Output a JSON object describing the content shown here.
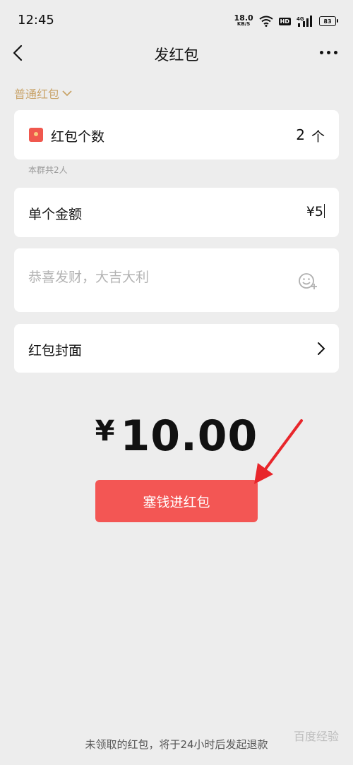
{
  "status_bar": {
    "time": "12:45",
    "net_speed": "18.0",
    "net_speed_unit": "KB/S",
    "hd_label": "HD",
    "signal_label": "4G",
    "battery": "83"
  },
  "nav": {
    "title": "发红包"
  },
  "packet_type": {
    "label": "普通红包"
  },
  "count_card": {
    "label": "红包个数",
    "value": "2",
    "unit": "个"
  },
  "group_hint": "本群共2人",
  "amount_card": {
    "label": "单个金额",
    "value": "¥5"
  },
  "message_card": {
    "placeholder": "恭喜发财，大吉大利"
  },
  "cover_card": {
    "label": "红包封面"
  },
  "total": {
    "currency": "¥",
    "amount": "10.00"
  },
  "submit_button": {
    "label": "塞钱进红包"
  },
  "footer_note": "未领取的红包，将于24小时后发起退款",
  "watermark": "百度经验",
  "colors": {
    "background": "#ededed",
    "card": "#ffffff",
    "accent_red": "#f35654",
    "packet_type_gold": "#c9a46a",
    "annotation_arrow": "#e8262b"
  }
}
